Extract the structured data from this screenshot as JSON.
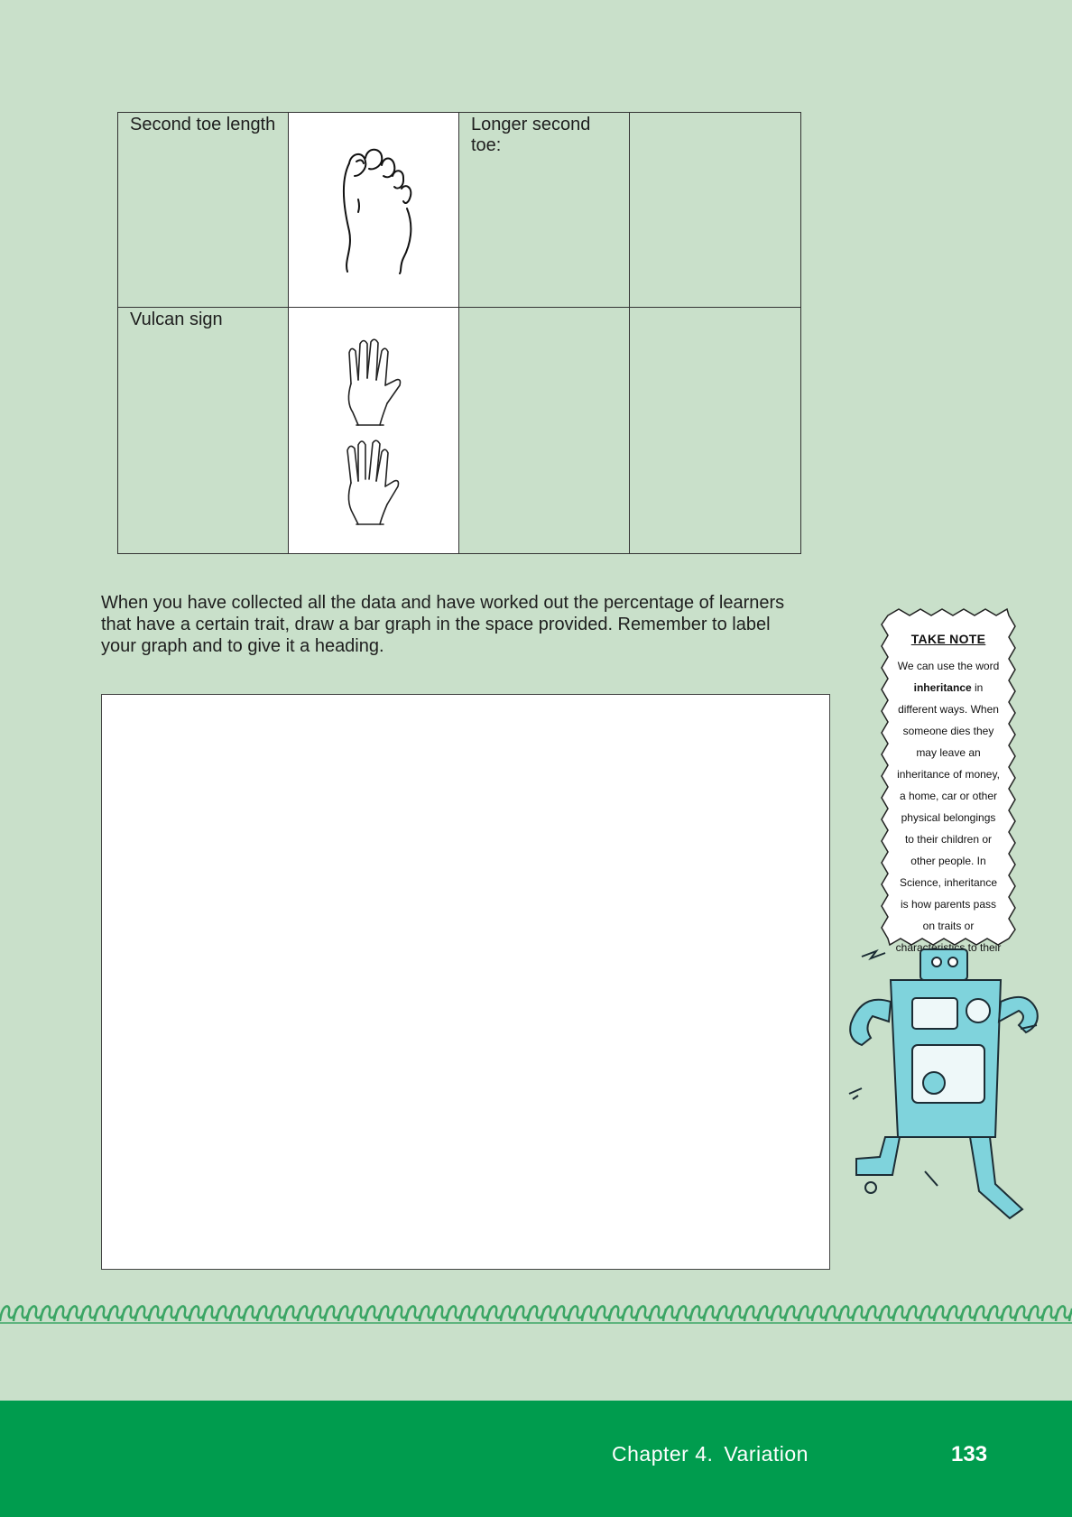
{
  "table": {
    "rows": [
      {
        "trait": "Second toe length",
        "col3": "Longer second toe:",
        "col4": "",
        "image_icon": "foot-illustration"
      },
      {
        "trait": "Vulcan sign",
        "col3": "",
        "col4": "",
        "image_icon": "vulcan-hand-illustration"
      }
    ]
  },
  "instructions": "When you have collected all the data and have worked out the percentage of learners that have a certain trait, draw a bar graph in the space provided. Remember to label your graph and to give it a heading.",
  "take_note": {
    "title": "TAKE NOTE",
    "body_pre": "We can use the word",
    "body_bold": "inheritance",
    "body_post": "in different ways. When someone dies they may leave an inheritance of money, a home, car or other physical belongings to their children or other people. In Science, inheritance is how parents pass on traits or characteristics to their children."
  },
  "footer": {
    "chapter_num": "Chapter 4.",
    "chapter_title": "Variation",
    "page_number": "133",
    "color": "#009c4e"
  },
  "colors": {
    "page_bg": "#c9e0ca",
    "robot": "#7fd3dc",
    "border_pattern": "#3aa564"
  }
}
